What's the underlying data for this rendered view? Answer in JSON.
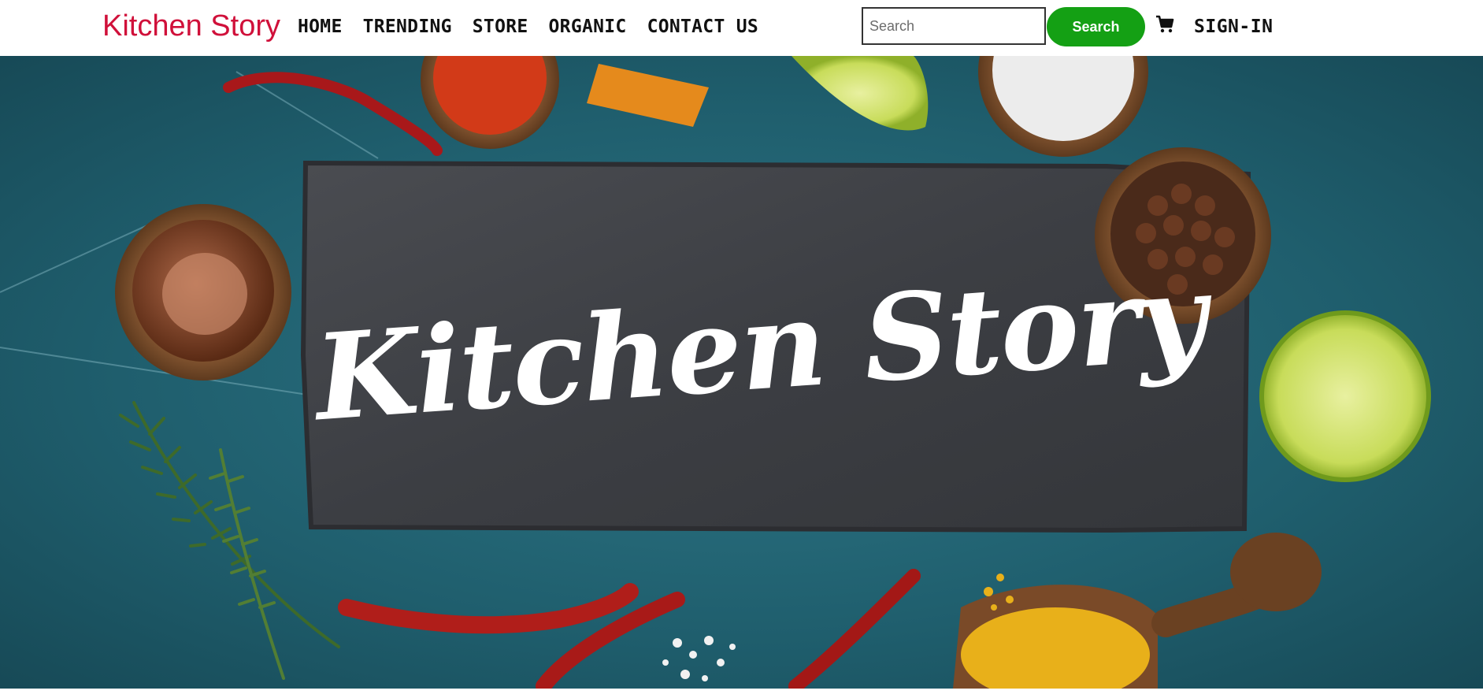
{
  "header": {
    "brand": "Kitchen Story",
    "nav": [
      {
        "label": "HOME"
      },
      {
        "label": "TRENDING"
      },
      {
        "label": "STORE"
      },
      {
        "label": "ORGANIC"
      },
      {
        "label": "CONTACT US"
      }
    ],
    "search": {
      "placeholder": "Search",
      "value": "",
      "button_label": "Search"
    },
    "cart_icon": "cart-icon",
    "sign_in_label": "SIGN-IN"
  },
  "hero": {
    "title": "Kitchen Story"
  },
  "colors": {
    "brand": "#d0103a",
    "search_button": "#14a014",
    "hero_background": "#1f5b6a",
    "slate": "#3d3f44"
  }
}
